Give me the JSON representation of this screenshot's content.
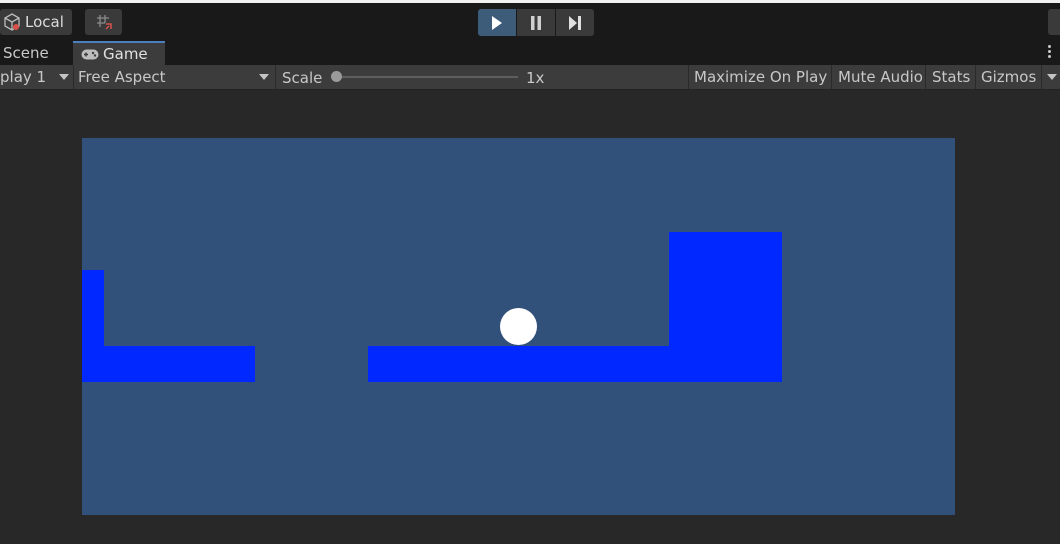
{
  "toolbar_top": {
    "local_label": "Local",
    "play_state": "playing"
  },
  "tabs": {
    "scene_label": "Scene",
    "game_label": "Game"
  },
  "game_toolbar": {
    "display_label": "play 1",
    "aspect_label": "Free Aspect",
    "scale_label": "Scale",
    "scale_value": "1x",
    "maximize_label": "Maximize On Play",
    "mute_label": "Mute Audio",
    "stats_label": "Stats",
    "gizmos_label": "Gizmos"
  },
  "colors": {
    "editor_bg": "#282828",
    "game_bg": "#31507a",
    "platform": "#0028ff",
    "ball": "#ffffff",
    "play_active": "#3c5c7a"
  }
}
